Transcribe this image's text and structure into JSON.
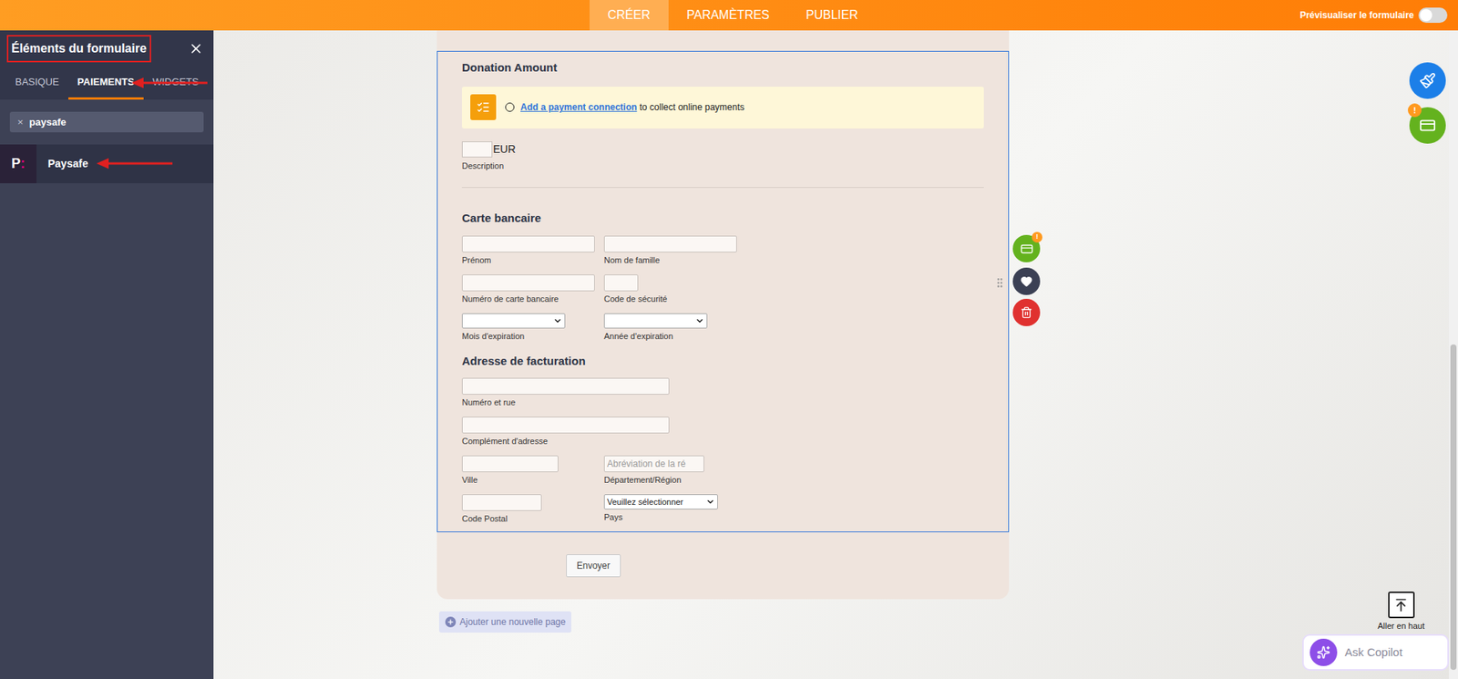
{
  "topbar": {
    "tabs": [
      {
        "label": "CRÉER",
        "selected": true
      },
      {
        "label": "PARAMÈTRES",
        "selected": false
      },
      {
        "label": "PUBLIER",
        "selected": false
      }
    ],
    "preview": {
      "label": "Prévisualiser le formulaire",
      "on": false
    }
  },
  "panel": {
    "title": "Éléments du formulaire",
    "title_boxed": true,
    "tabs": [
      {
        "label": "BASIQUE",
        "selected": false,
        "arrow": false
      },
      {
        "label": "PAIEMENTS",
        "selected": true,
        "arrow": true
      },
      {
        "label": "WIDGETS",
        "selected": false,
        "arrow": false
      }
    ],
    "search": {
      "value": "paysafe",
      "clear": "×"
    },
    "items": [
      {
        "label": "Paysafe",
        "logo_letter": "P",
        "logo_mark": ":",
        "arrow": true
      }
    ]
  },
  "form": {
    "donation": {
      "title": "Donation Amount",
      "notice_radio_selected": false,
      "notice_link": "Add a payment connection",
      "notice_text": " to collect online payments",
      "currency": "EUR",
      "description": "Description"
    },
    "card": {
      "title": "Carte bancaire",
      "rows": [
        [
          {
            "label": "Prénom",
            "kind": "name",
            "value": ""
          },
          {
            "label": "Nom de famille",
            "kind": "name",
            "value": ""
          }
        ],
        [
          {
            "label": "Numéro de carte bancaire",
            "kind": "name",
            "value": ""
          },
          {
            "label": "Code de sécurité",
            "kind": "cvv",
            "value": ""
          }
        ],
        [
          {
            "label": "Mois d'expiration",
            "kind": "select",
            "value": ""
          },
          {
            "label": "Année d'expiration",
            "kind": "select",
            "value": ""
          }
        ]
      ]
    },
    "billing": {
      "title": "Adresse de facturation",
      "rows": [
        [
          {
            "label": "Numéro et rue",
            "kind": "long",
            "value": ""
          }
        ],
        [
          {
            "label": "Complément d'adresse",
            "kind": "long",
            "value": ""
          }
        ],
        [
          {
            "label": "Ville",
            "kind": "city",
            "value": ""
          },
          {
            "label": "Département/Région",
            "kind": "state",
            "placeholder": "Abréviation de la ré",
            "value": ""
          }
        ],
        [
          {
            "label": "Code Postal",
            "kind": "zip",
            "value": ""
          },
          {
            "label": "Pays",
            "kind": "country",
            "value": "Veuillez sélectionner"
          }
        ]
      ]
    },
    "selected": true,
    "submit": "Envoyer",
    "add_page": "Ajouter une nouvelle page"
  },
  "floating": {
    "payment_badge": "!",
    "tool_badge": "!"
  },
  "go_top": "Aller en haut",
  "copilot": {
    "placeholder": "Ask Copilot"
  }
}
